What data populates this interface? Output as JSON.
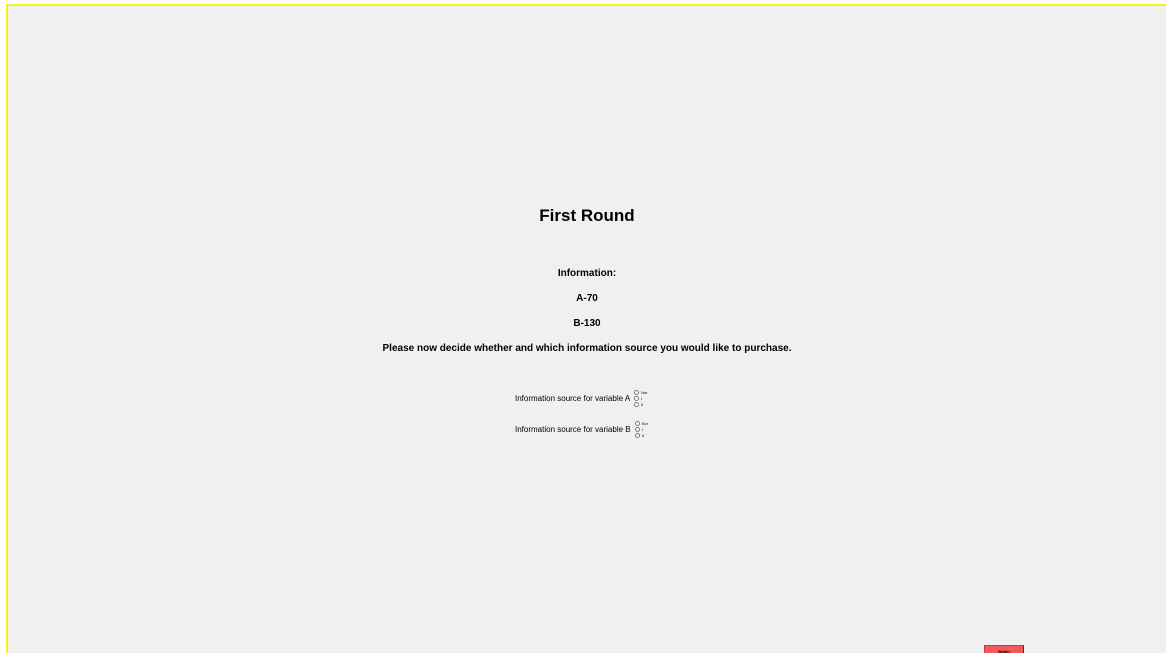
{
  "page": {
    "title": "First Round",
    "info_heading": "Information:",
    "info_a": "A-70",
    "info_b": "B-130",
    "instruction": "Please now decide whether and which information source you would like to purchase."
  },
  "questions": [
    {
      "label": "Information source for variable A",
      "options": [
        "Nor",
        "I",
        "II"
      ]
    },
    {
      "label": "Information source for variable B",
      "options": [
        "Nor",
        "I",
        "II"
      ]
    }
  ],
  "buttons": {
    "next_label": "Weiter"
  },
  "colors": {
    "frame_border": "#f6f11a",
    "background": "#f0f0f0",
    "next_button": "#f25a5a"
  }
}
